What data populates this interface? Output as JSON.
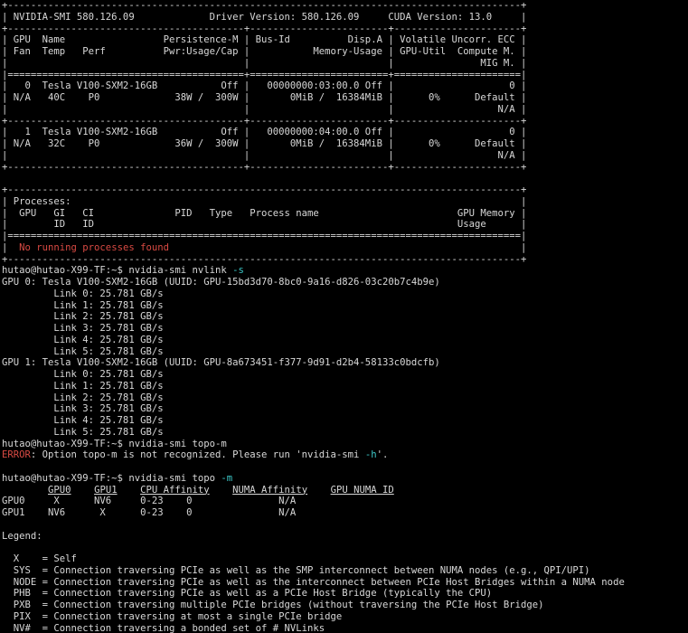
{
  "terminal": {
    "colors": {
      "background": "#000000",
      "foreground": "#d8d8d8",
      "error": "#d94a43",
      "flag": "#3cc8c8"
    },
    "lines": [
      [
        {
          "t": "+-----------------------------------------------------------------------------------------+"
        }
      ],
      [
        {
          "t": "| NVIDIA-SMI 580.126.09             Driver Version: 580.126.09     CUDA Version: 13.0     |"
        }
      ],
      [
        {
          "t": "+-----------------------------------------+------------------------+----------------------+"
        }
      ],
      [
        {
          "t": "| GPU  Name                 Persistence-M | Bus-Id          Disp.A | Volatile Uncorr. ECC |"
        }
      ],
      [
        {
          "t": "| Fan  Temp   Perf          Pwr:Usage/Cap |           Memory-Usage | GPU-Util  Compute M. |"
        }
      ],
      [
        {
          "t": "|                                         |                        |               MIG M. |"
        }
      ],
      [
        {
          "t": "|=========================================+========================+======================|"
        }
      ],
      [
        {
          "t": "|   0  Tesla V100-SXM2-16GB           Off |   00000000:03:00.0 Off |                    0 |"
        }
      ],
      [
        {
          "t": "| N/A   40C    P0             38W /  300W |       0MiB /  16384MiB |      0%      Default |"
        }
      ],
      [
        {
          "t": "|                                         |                        |                  N/A |"
        }
      ],
      [
        {
          "t": "+-----------------------------------------+------------------------+----------------------+"
        }
      ],
      [
        {
          "t": "|   1  Tesla V100-SXM2-16GB           Off |   00000000:04:00.0 Off |                    0 |"
        }
      ],
      [
        {
          "t": "| N/A   32C    P0             36W /  300W |       0MiB /  16384MiB |      0%      Default |"
        }
      ],
      [
        {
          "t": "|                                         |                        |                  N/A |"
        }
      ],
      [
        {
          "t": "+-----------------------------------------+------------------------+----------------------+"
        }
      ],
      [
        {
          "t": ""
        }
      ],
      [
        {
          "t": "+-----------------------------------------------------------------------------------------+"
        }
      ],
      [
        {
          "t": "| Processes:                                                                              |"
        }
      ],
      [
        {
          "t": "|  GPU   GI   CI              PID   Type   Process name                        GPU Memory |"
        }
      ],
      [
        {
          "t": "|        ID   ID                                                               Usage      |"
        }
      ],
      [
        {
          "t": "|=========================================================================================|"
        }
      ],
      [
        {
          "t": "|  "
        },
        {
          "t": "No running processes found",
          "c": "red"
        },
        {
          "t": "                                                             |"
        }
      ],
      [
        {
          "t": "+-----------------------------------------------------------------------------------------+"
        }
      ],
      [
        {
          "t": "hutao@hutao-X99-TF:~$ nvidia-smi nvlink "
        },
        {
          "t": "-s",
          "c": "cyan"
        }
      ],
      [
        {
          "t": "GPU 0: Tesla V100-SXM2-16GB (UUID: GPU-15bd3d70-8bc0-9a16-d826-03c20b7c4b9e)"
        }
      ],
      [
        {
          "t": "         Link 0: 25.781 GB/s"
        }
      ],
      [
        {
          "t": "         Link 1: 25.781 GB/s"
        }
      ],
      [
        {
          "t": "         Link 2: 25.781 GB/s"
        }
      ],
      [
        {
          "t": "         Link 3: 25.781 GB/s"
        }
      ],
      [
        {
          "t": "         Link 4: 25.781 GB/s"
        }
      ],
      [
        {
          "t": "         Link 5: 25.781 GB/s"
        }
      ],
      [
        {
          "t": "GPU 1: Tesla V100-SXM2-16GB (UUID: GPU-8a673451-f377-9d91-d2b4-58133c0bdcfb)"
        }
      ],
      [
        {
          "t": "         Link 0: 25.781 GB/s"
        }
      ],
      [
        {
          "t": "         Link 1: 25.781 GB/s"
        }
      ],
      [
        {
          "t": "         Link 2: 25.781 GB/s"
        }
      ],
      [
        {
          "t": "         Link 3: 25.781 GB/s"
        }
      ],
      [
        {
          "t": "         Link 4: 25.781 GB/s"
        }
      ],
      [
        {
          "t": "         Link 5: 25.781 GB/s"
        }
      ],
      [
        {
          "t": "hutao@hutao-X99-TF:~$ nvidia-smi topo-m"
        }
      ],
      [
        {
          "t": "ERROR",
          "c": "red"
        },
        {
          "t": ": Option topo-m is not recognized. Please run 'nvidia-smi "
        },
        {
          "t": "-h",
          "c": "cyan"
        },
        {
          "t": "'."
        }
      ],
      [
        {
          "t": ""
        }
      ],
      [
        {
          "t": "hutao@hutao-X99-TF:~$ nvidia-smi topo "
        },
        {
          "t": "-m",
          "c": "cyan"
        }
      ],
      [
        {
          "t": "        "
        },
        {
          "t": "GPU0",
          "c": "ul"
        },
        {
          "t": "    "
        },
        {
          "t": "GPU1",
          "c": "ul"
        },
        {
          "t": "    "
        },
        {
          "t": "CPU Affinity",
          "c": "ul"
        },
        {
          "t": "    "
        },
        {
          "t": "NUMA Affinity",
          "c": "ul"
        },
        {
          "t": "    "
        },
        {
          "t": "GPU NUMA ID",
          "c": "ul"
        }
      ],
      [
        {
          "t": "GPU0     X      NV6     0-23    0               N/A"
        }
      ],
      [
        {
          "t": "GPU1    NV6      X      0-23    0               N/A"
        }
      ],
      [
        {
          "t": ""
        }
      ],
      [
        {
          "t": "Legend:"
        }
      ],
      [
        {
          "t": ""
        }
      ],
      [
        {
          "t": "  X    = Self"
        }
      ],
      [
        {
          "t": "  SYS  = Connection traversing PCIe as well as the SMP interconnect between NUMA nodes (e.g., QPI/UPI)"
        }
      ],
      [
        {
          "t": "  NODE = Connection traversing PCIe as well as the interconnect between PCIe Host Bridges within a NUMA node"
        }
      ],
      [
        {
          "t": "  PHB  = Connection traversing PCIe as well as a PCIe Host Bridge (typically the CPU)"
        }
      ],
      [
        {
          "t": "  PXB  = Connection traversing multiple PCIe bridges (without traversing the PCIe Host Bridge)"
        }
      ],
      [
        {
          "t": "  PIX  = Connection traversing at most a single PCIe bridge"
        }
      ],
      [
        {
          "t": "  NV#  = Connection traversing a bonded set of # NVLinks"
        }
      ]
    ]
  }
}
